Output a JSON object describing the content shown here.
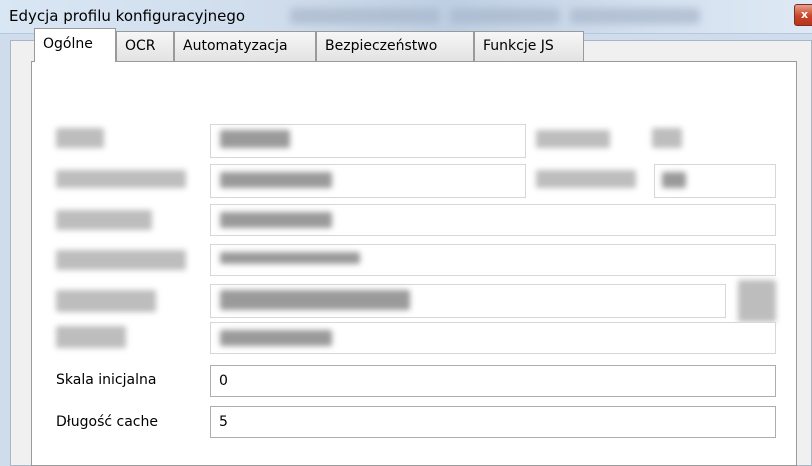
{
  "window": {
    "title": "Edycja profilu konfiguracyjnego",
    "close_glyph": "x"
  },
  "tabs": [
    {
      "label": "Ogólne",
      "active": true
    },
    {
      "label": "OCR",
      "active": false
    },
    {
      "label": "Automatyzacja",
      "active": false
    },
    {
      "label": "Bezpieczeństwo",
      "active": false
    },
    {
      "label": "Funkcje JS",
      "active": false
    }
  ],
  "fields": {
    "initial_scale": {
      "label": "Skala inicjalna",
      "value": "0"
    },
    "cache_length": {
      "label": "Długość cache",
      "value": "5"
    }
  },
  "icons": {
    "close": "close-icon"
  }
}
